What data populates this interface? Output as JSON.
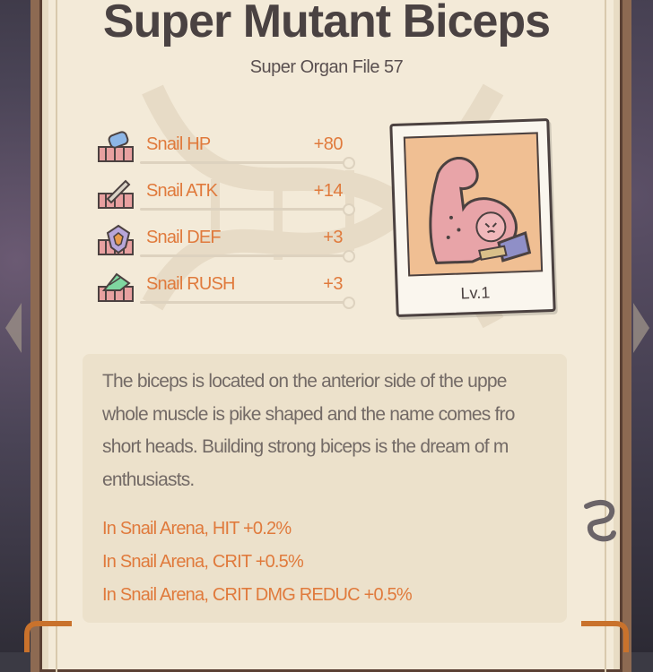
{
  "card": {
    "title": "Super Mutant Biceps",
    "subtitle": "Super Organ File 57"
  },
  "stats": [
    {
      "name": "Snail HP",
      "value": "+80",
      "icon": "hp-icon"
    },
    {
      "name": "Snail ATK",
      "value": "+14",
      "icon": "sword-icon"
    },
    {
      "name": "Snail DEF",
      "value": "+3",
      "icon": "shield-icon"
    },
    {
      "name": "Snail RUSH",
      "value": "+3",
      "icon": "rush-icon"
    }
  ],
  "photo": {
    "level": "Lv.1",
    "image": "flexed-bicep-icon"
  },
  "description": {
    "lines": [
      "The biceps is located on the anterior side of the uppe",
      "whole muscle is pike shaped and the name comes fro",
      "short heads. Building strong biceps is the dream of m",
      "enthusiasts."
    ]
  },
  "effects": [
    "In Snail Arena, HIT +0.2%",
    "In Snail Arena, CRIT +0.5%",
    "In Snail Arena, CRIT DMG REDUC +0.5%"
  ],
  "colors": {
    "accent": "#e07a3c",
    "paper": "#f3ead8",
    "frame": "#8d6a52",
    "text": "#4a4242"
  }
}
